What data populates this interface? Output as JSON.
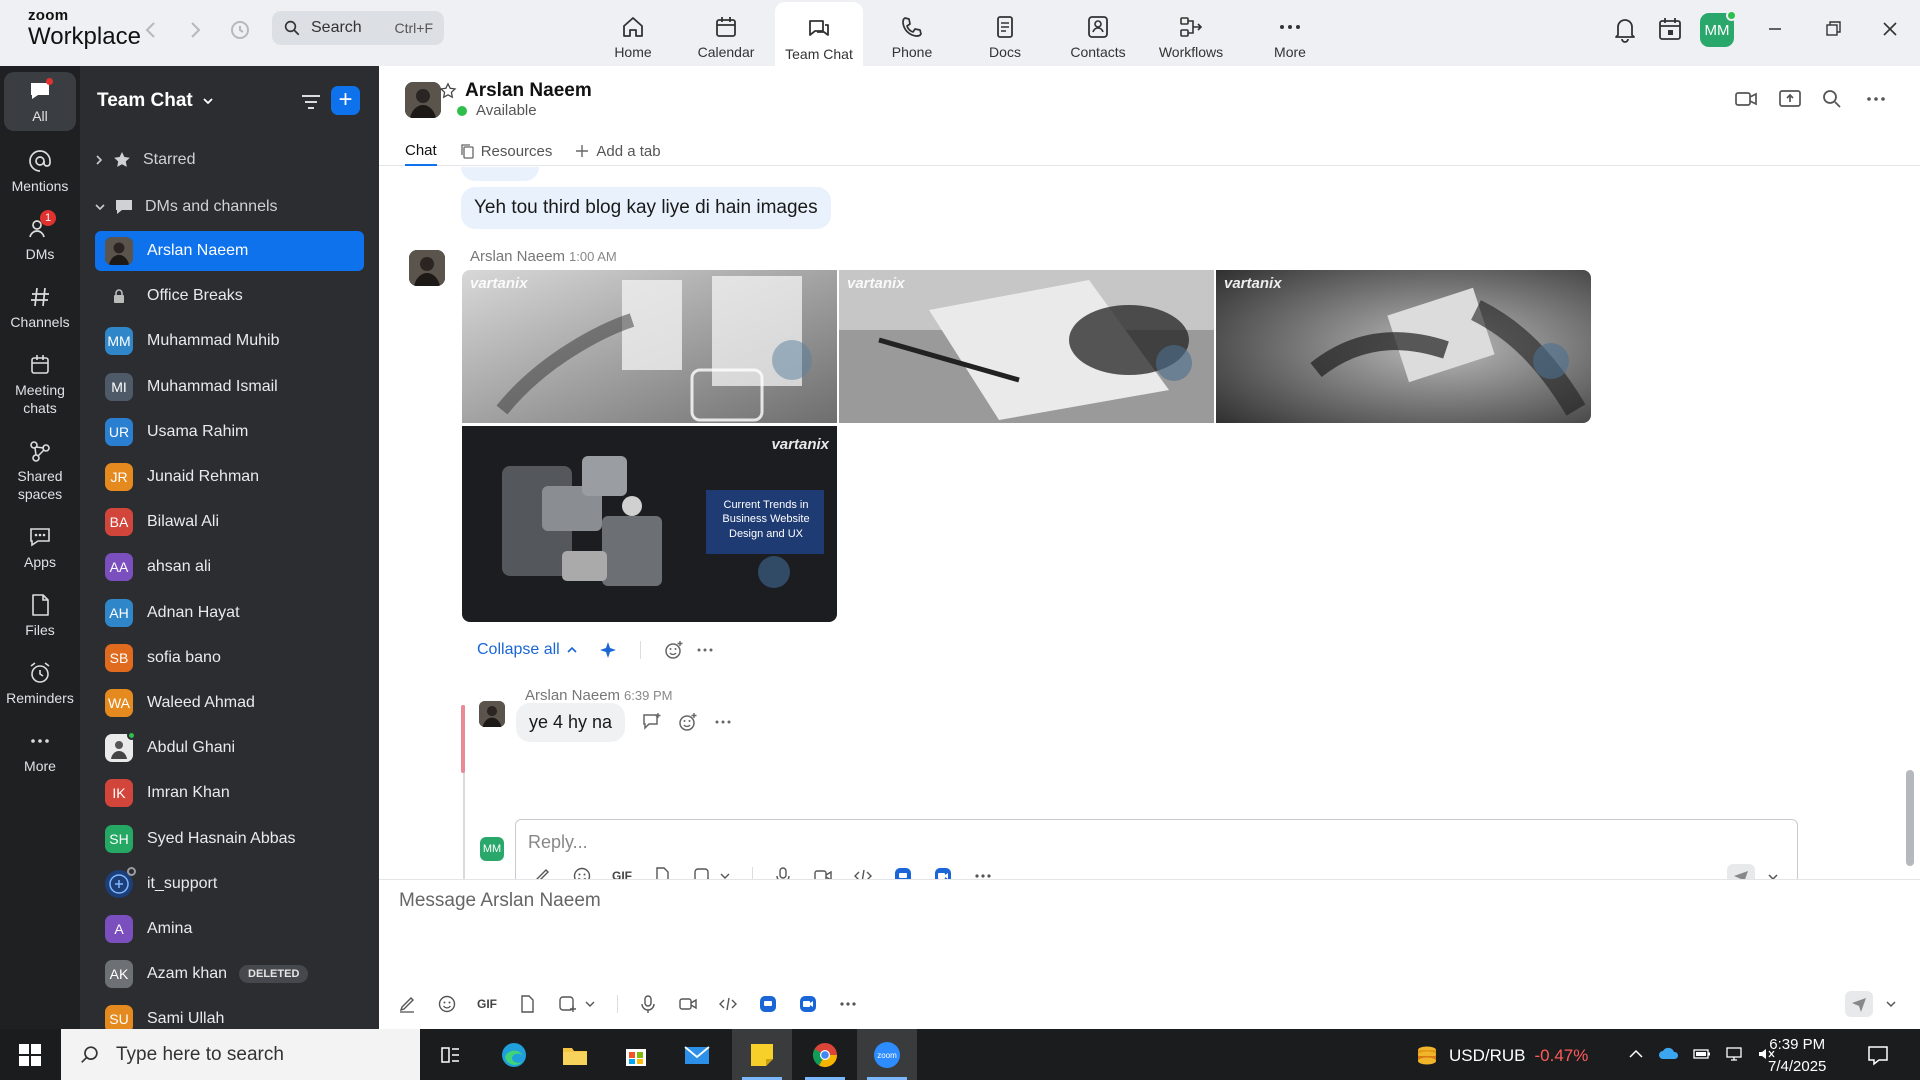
{
  "app": {
    "logo_top": "zoom",
    "logo_bottom": "Workplace"
  },
  "top_search": {
    "label": "Search",
    "shortcut": "Ctrl+F"
  },
  "nav_tabs": [
    {
      "label": "Home",
      "icon": "home-icon"
    },
    {
      "label": "Calendar",
      "icon": "calendar-icon"
    },
    {
      "label": "Team Chat",
      "icon": "chat-icon",
      "active": true
    },
    {
      "label": "Phone",
      "icon": "phone-icon"
    },
    {
      "label": "Docs",
      "icon": "docs-icon"
    },
    {
      "label": "Contacts",
      "icon": "contacts-icon"
    },
    {
      "label": "Workflows",
      "icon": "workflows-icon"
    },
    {
      "label": "More",
      "icon": "more-icon"
    }
  ],
  "user_avatar": "MM",
  "rail": [
    {
      "label": "All",
      "icon": "chat-bubble-icon",
      "active": true
    },
    {
      "label": "Mentions",
      "icon": "at-icon"
    },
    {
      "label": "DMs",
      "icon": "people-icon",
      "badge": "1"
    },
    {
      "label": "Channels",
      "icon": "hash-icon"
    },
    {
      "label": "Meeting chats",
      "icon": "calendar-icon"
    },
    {
      "label": "Shared spaces",
      "icon": "shared-spaces-icon"
    },
    {
      "label": "Apps",
      "icon": "apps-icon"
    },
    {
      "label": "Files",
      "icon": "file-icon"
    },
    {
      "label": "Reminders",
      "icon": "alarm-icon"
    },
    {
      "label": "More",
      "icon": "more-icon"
    }
  ],
  "sidebar": {
    "title": "Team Chat",
    "sections": {
      "starred": "Starred",
      "dms": "DMs and channels"
    },
    "contacts": [
      {
        "name": "Arslan Naeem",
        "initials": "",
        "color": "#3d3a36",
        "status": "",
        "active": true
      },
      {
        "name": "Office Breaks",
        "initials": "",
        "color": "#4a4d52",
        "status": "lock"
      },
      {
        "name": "Muhammad Muhib",
        "initials": "MM",
        "color": "#2f87c9",
        "status": "#2dbf4a"
      },
      {
        "name": "Muhammad Ismail",
        "initials": "MI",
        "color": "#4f5a68",
        "status": ""
      },
      {
        "name": "Usama Rahim",
        "initials": "UR",
        "color": "#2b7fd1",
        "status": "#2dbf4a"
      },
      {
        "name": "Junaid Rehman",
        "initials": "JR",
        "color": "#e58a1f",
        "status": "#2dbf4a"
      },
      {
        "name": "Bilawal Ali",
        "initials": "BA",
        "color": "#d2453b",
        "status": "#2dbf4a"
      },
      {
        "name": "ahsan ali",
        "initials": "AA",
        "color": "#7b4fbd",
        "status": "#9a9da2"
      },
      {
        "name": "Adnan Hayat",
        "initials": "AH",
        "color": "#2f87c9",
        "status": "#2dbf4a"
      },
      {
        "name": "sofia bano",
        "initials": "SB",
        "color": "#e06b1f",
        "status": "#2dbf4a"
      },
      {
        "name": "Waleed Ahmad",
        "initials": "WA",
        "color": "#e58a1f",
        "status": "#2dbf4a"
      },
      {
        "name": "Abdul Ghani",
        "initials": "",
        "color": "#eaeaea",
        "status": "#2dbf4a"
      },
      {
        "name": "Imran Khan",
        "initials": "IK",
        "color": "#d2453b",
        "status": "#2dbf4a"
      },
      {
        "name": "Syed Hasnain Abbas",
        "initials": "SH",
        "color": "#24a864",
        "status": ""
      },
      {
        "name": "it_support",
        "initials": "",
        "color": "#1c3f7a",
        "status": "#9a9da2"
      },
      {
        "name": "Amina",
        "initials": "A",
        "color": "#7b4fbd",
        "status": ""
      },
      {
        "name": "Azam khan",
        "initials": "AK",
        "color": "#6d7075",
        "status": "#9a9da2",
        "tag": "DELETED"
      },
      {
        "name": "Sami Ullah",
        "initials": "SU",
        "color": "#e58a1f",
        "status": "#2dbf4a"
      }
    ]
  },
  "chat": {
    "name": "Arslan Naeem",
    "status": "Available",
    "tabs": [
      "Chat",
      "Resources",
      "Add a tab"
    ],
    "prev_message": "Yeh tou third blog kay liye di hain images",
    "msg_sender": "Arslan Naeem",
    "msg_time": "1:00 AM",
    "watermark": "vartanix",
    "card_text": "Current Trends in Business Website Design and UX",
    "collapse_label": "Collapse all",
    "reply": {
      "sender": "Arslan Naeem",
      "time": "6:39 PM",
      "text": "ye 4 hy na"
    },
    "reply_placeholder": "Reply...",
    "reply_avatar": "MM",
    "compose_placeholder": "Message Arslan Naeem",
    "gif_label": "GIF"
  },
  "taskbar": {
    "search_placeholder": "Type here to search",
    "ticker": "USD/RUB",
    "change": "-0.47%",
    "time": "6:39 PM",
    "date": "7/4/2025"
  }
}
